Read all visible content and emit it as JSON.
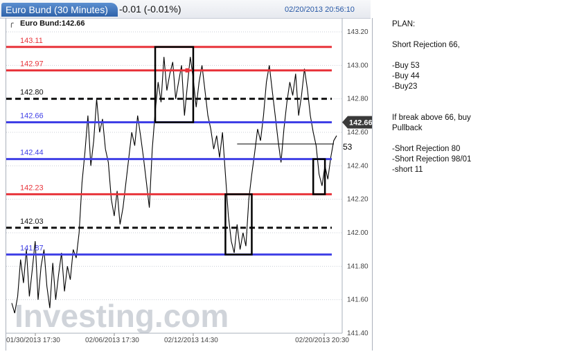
{
  "header": {
    "title": "Euro Bund (30 Minutes)",
    "change": "-0.01 (-0.01%)",
    "datetime": "02/20/2013 20:56:10"
  },
  "chart_data": {
    "type": "line",
    "instrument_label": "Euro Bund:142.66",
    "current_price": 142.66,
    "current_price_label": "142.66",
    "ylim": [
      141.4,
      143.2
    ],
    "y_ticks": [
      "143.20",
      "143.00",
      "142.80",
      "142.60",
      "142.40",
      "142.20",
      "142.00",
      "141.80",
      "141.60",
      "141.40"
    ],
    "x_ticks": [
      "01/30/2013 17:30",
      "02/06/2013 17:30",
      "02/12/2013 14:30",
      "02/20/2013 20:30"
    ],
    "grid": true,
    "series": [
      {
        "values": [
          141.58,
          141.52,
          141.62,
          141.84,
          141.7,
          141.9,
          141.62,
          141.78,
          141.95,
          141.6,
          141.8,
          141.9,
          141.68,
          141.55,
          141.82,
          141.6,
          141.75,
          141.88,
          141.65,
          141.8,
          141.72,
          141.9,
          141.85,
          142.0,
          142.3,
          142.48,
          142.7,
          142.4,
          142.55,
          142.8,
          142.6,
          142.68,
          142.5,
          142.42,
          142.2,
          142.1,
          142.25,
          142.05,
          142.15,
          142.3,
          142.45,
          142.6,
          142.52,
          142.7,
          142.58,
          142.45,
          142.3,
          142.15,
          142.5,
          142.72,
          142.9,
          142.78,
          143.05,
          142.85,
          142.95,
          143.02,
          142.8,
          142.9,
          143.0,
          142.7,
          142.88,
          143.05,
          142.92,
          142.75,
          142.9,
          143.0,
          142.85,
          142.7,
          142.62,
          142.5,
          142.58,
          142.45,
          142.6,
          142.35,
          142.1,
          141.95,
          141.88,
          142.05,
          141.9,
          142.0,
          141.92,
          142.2,
          142.35,
          142.48,
          142.62,
          142.55,
          142.7,
          142.9,
          143.0,
          142.85,
          142.7,
          142.55,
          142.42,
          142.62,
          142.78,
          142.9,
          142.82,
          142.95,
          142.7,
          142.82,
          142.98,
          142.86,
          142.7,
          142.6,
          142.52,
          142.35,
          142.28,
          142.4,
          142.32,
          142.45,
          142.55,
          142.58
        ]
      }
    ],
    "levels": [
      {
        "value": 143.11,
        "label": "143.11",
        "color": "#e8333a",
        "style": "solid"
      },
      {
        "value": 142.97,
        "label": "142.97",
        "color": "#e8333a",
        "style": "solid"
      },
      {
        "value": 142.8,
        "label": "142.80",
        "color": "#111111",
        "style": "dashed"
      },
      {
        "value": 142.66,
        "label": "142.66",
        "color": "#3f3fe6",
        "style": "solid"
      },
      {
        "value": 142.44,
        "label": "142.44",
        "color": "#3f3fe6",
        "style": "solid"
      },
      {
        "value": 142.23,
        "label": "142.23",
        "color": "#e8333a",
        "style": "solid"
      },
      {
        "value": 142.03,
        "label": "142.03",
        "color": "#111111",
        "style": "dashed"
      },
      {
        "value": 141.87,
        "label": "141.87",
        "color": "#3f3fe6",
        "style": "solid"
      }
    ],
    "annotation_text": "53",
    "watermark": "Investing.com"
  },
  "notes": [
    "PLAN:",
    "",
    "Short Rejection 66,",
    "",
    "-Buy 53",
    "-Buy 44",
    "-Buy23",
    "",
    "",
    "If break above 66, buy",
    "Pullback",
    "",
    "-Short Rejection 80",
    "-Short Rejection 98/01",
    "-short 11"
  ]
}
